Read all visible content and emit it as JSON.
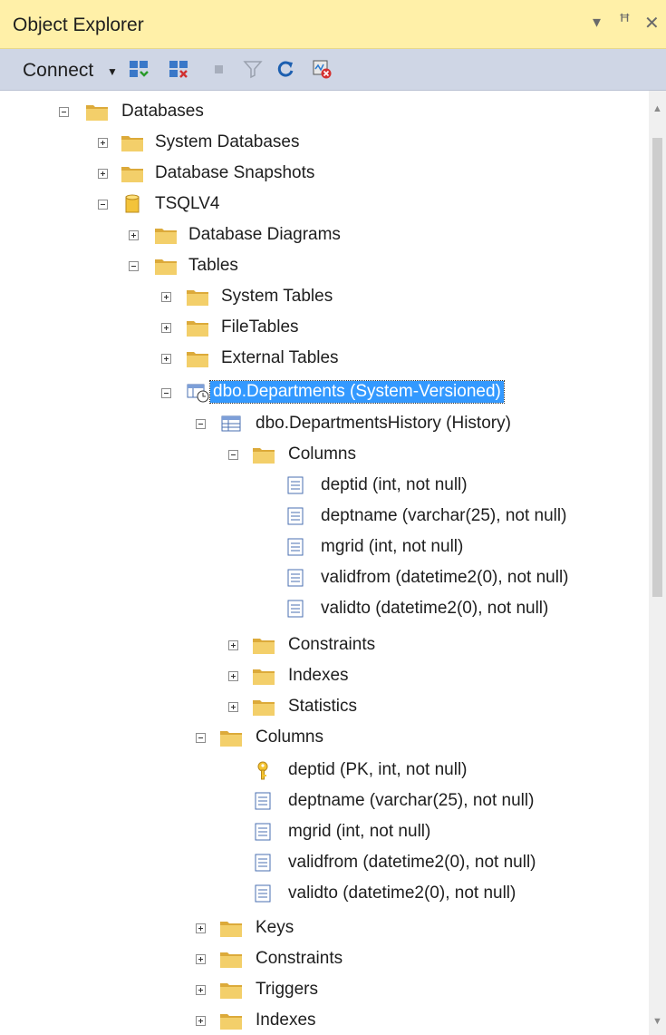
{
  "window": {
    "title": "Object Explorer",
    "controls": {
      "dropdown_icon": "▾",
      "pin_icon": "ꟸ",
      "close_icon": "✕"
    }
  },
  "toolbar": {
    "connect_label": "Connect",
    "icons": [
      "connect-object-explorer-icon",
      "disconnect-icon",
      "stop-icon",
      "filter-icon",
      "refresh-icon",
      "activity-monitor-icon"
    ]
  },
  "colors": {
    "selection": "#3399ff",
    "titlebar": "#fff0a8",
    "toolbar": "#cfd6e5",
    "folder": "#e8b84a"
  },
  "tree": {
    "databases": "Databases",
    "system_databases": "System Databases",
    "database_snapshots": "Database Snapshots",
    "tsqlv4": "TSQLV4",
    "database_diagrams": "Database Diagrams",
    "tables": "Tables",
    "system_tables": "System Tables",
    "filetables": "FileTables",
    "external_tables": "External Tables",
    "departments": "dbo.Departments (System-Versioned)",
    "history": "dbo.DepartmentsHistory (History)",
    "history_columns": "Columns",
    "history_cols": [
      "deptid (int, not null)",
      "deptname (varchar(25), not null)",
      "mgrid (int, not null)",
      "validfrom (datetime2(0), not null)",
      "validto (datetime2(0), not null)"
    ],
    "history_constraints": "Constraints",
    "history_indexes": "Indexes",
    "history_statistics": "Statistics",
    "columns": "Columns",
    "cols": [
      "deptid (PK, int, not null)",
      "deptname (varchar(25), not null)",
      "mgrid (int, not null)",
      "validfrom (datetime2(0), not null)",
      "validto (datetime2(0), not null)"
    ],
    "keys": "Keys",
    "constraints": "Constraints",
    "triggers": "Triggers",
    "indexes": "Indexes"
  }
}
